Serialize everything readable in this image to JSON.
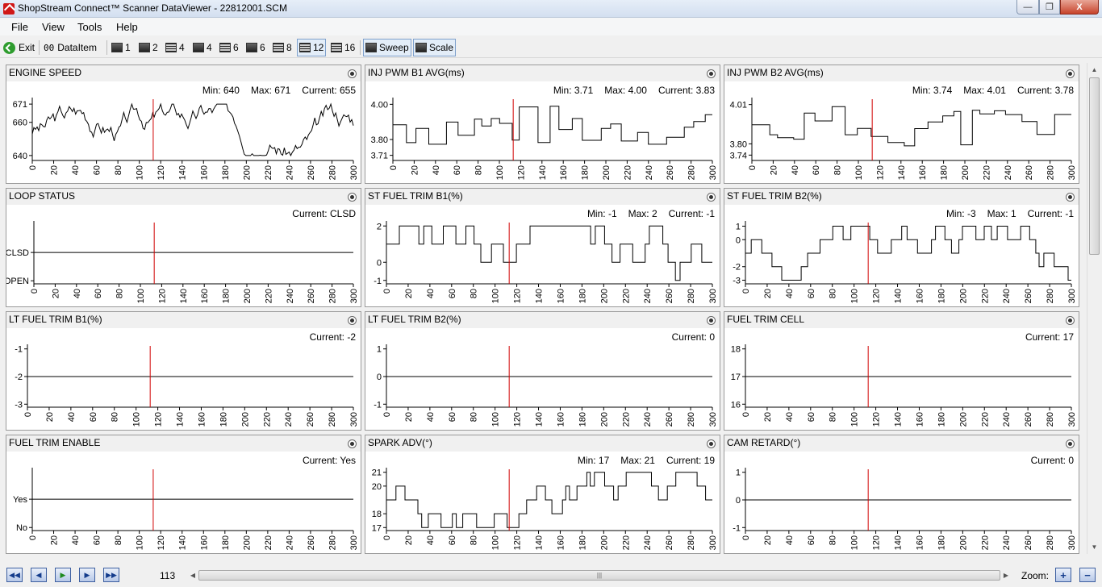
{
  "window": {
    "title": "ShopStream Connect™ Scanner DataViewer - 22812001.SCM",
    "min_glyph": "—",
    "max_glyph": "❐",
    "close_glyph": "X"
  },
  "menu": [
    "File",
    "View",
    "Tools",
    "Help"
  ],
  "toolbar": {
    "exit": "Exit",
    "dataitem": "DataItem",
    "dataitem_icon": "00",
    "layouts": [
      "1",
      "2",
      "4",
      "4",
      "6",
      "6",
      "8",
      "12",
      "16"
    ],
    "active_layout_index": 7,
    "sweep": "Sweep",
    "scale": "Scale"
  },
  "x_ticks": [
    "0",
    "20",
    "40",
    "60",
    "80",
    "100",
    "120",
    "140",
    "160",
    "180",
    "200",
    "220",
    "240",
    "260",
    "280",
    "300"
  ],
  "cursor_position": 113,
  "panels": [
    {
      "title": "ENGINE SPEED",
      "min": "Min: 640",
      "max": "Max: 671",
      "current": "Current: 655",
      "y_ticks": [
        {
          "label": "671",
          "v": 671
        },
        {
          "label": "660",
          "v": 660
        },
        {
          "label": "640",
          "v": 640
        }
      ],
      "y_range": [
        638,
        673
      ],
      "pattern": "noisy",
      "series_range": [
        640,
        671
      ],
      "seed": 3
    },
    {
      "title": "INJ PWM B1 AVG(ms)",
      "min": "Min: 3.71",
      "max": "Max: 4.00",
      "current": "Current: 3.83",
      "y_ticks": [
        {
          "label": "4.00",
          "v": 4.0
        },
        {
          "label": "3.80",
          "v": 3.8
        },
        {
          "label": "3.71",
          "v": 3.71
        }
      ],
      "y_range": [
        3.69,
        4.02
      ],
      "pattern": "step",
      "series_range": [
        3.71,
        4.0
      ],
      "seed": 7
    },
    {
      "title": "INJ PWM B2 AVG(ms)",
      "min": "Min: 3.74",
      "max": "Max: 4.01",
      "current": "Current: 3.78",
      "y_ticks": [
        {
          "label": "4.01",
          "v": 4.01
        },
        {
          "label": "3.80",
          "v": 3.8
        },
        {
          "label": "3.74",
          "v": 3.74
        }
      ],
      "y_range": [
        3.72,
        4.03
      ],
      "pattern": "step",
      "series_range": [
        3.74,
        4.01
      ],
      "seed": 11
    },
    {
      "title": "LOOP STATUS",
      "min": "",
      "max": "",
      "current": "Current: CLSD",
      "y_ticks": [
        {
          "label": "CLSD",
          "v": 1
        },
        {
          "label": "OPEN",
          "v": 0
        }
      ],
      "y_range": [
        -0.05,
        2.0
      ],
      "pattern": "flat",
      "flat_value": 1,
      "seed": 1
    },
    {
      "title": "ST FUEL TRIM B1(%)",
      "min": "Min: -1",
      "max": "Max: 2",
      "current": "Current: -1",
      "y_ticks": [
        {
          "label": "2",
          "v": 2
        },
        {
          "label": "0",
          "v": 0
        },
        {
          "label": "-1",
          "v": -1
        }
      ],
      "y_range": [
        -1.1,
        2.1
      ],
      "pattern": "levels",
      "levels": [
        -1,
        0,
        1,
        2
      ],
      "seed": 5
    },
    {
      "title": "ST FUEL TRIM B2(%)",
      "min": "Min: -3",
      "max": "Max: 1",
      "current": "Current: -1",
      "y_ticks": [
        {
          "label": "1",
          "v": 1
        },
        {
          "label": "0",
          "v": 0
        },
        {
          "label": "-2",
          "v": -2
        },
        {
          "label": "-3",
          "v": -3
        }
      ],
      "y_range": [
        -3.15,
        1.15
      ],
      "pattern": "levels",
      "levels": [
        -3,
        -2,
        -1,
        0,
        1
      ],
      "seed": 9
    },
    {
      "title": "LT FUEL TRIM B1(%)",
      "min": "",
      "max": "",
      "current": "Current: -2",
      "y_ticks": [
        {
          "label": "-1",
          "v": -1
        },
        {
          "label": "-2",
          "v": -2
        },
        {
          "label": "-3",
          "v": -3
        }
      ],
      "y_range": [
        -3.05,
        -0.95
      ],
      "pattern": "flat",
      "flat_value": -2,
      "seed": 1
    },
    {
      "title": "LT FUEL TRIM B2(%)",
      "min": "",
      "max": "",
      "current": "Current: 0",
      "y_ticks": [
        {
          "label": "1",
          "v": 1
        },
        {
          "label": "0",
          "v": 0
        },
        {
          "label": "-1",
          "v": -1
        }
      ],
      "y_range": [
        -1.05,
        1.05
      ],
      "pattern": "flat",
      "flat_value": 0,
      "seed": 1
    },
    {
      "title": "FUEL TRIM CELL",
      "min": "",
      "max": "",
      "current": "Current: 17",
      "y_ticks": [
        {
          "label": "18",
          "v": 18
        },
        {
          "label": "17",
          "v": 17
        },
        {
          "label": "16",
          "v": 16
        }
      ],
      "y_range": [
        15.95,
        18.05
      ],
      "pattern": "flat",
      "flat_value": 17,
      "seed": 1
    },
    {
      "title": "FUEL TRIM ENABLE",
      "min": "",
      "max": "",
      "current": "Current: Yes",
      "y_ticks": [
        {
          "label": "Yes",
          "v": 1
        },
        {
          "label": "No",
          "v": 0
        }
      ],
      "y_range": [
        -0.05,
        2.0
      ],
      "pattern": "flat",
      "flat_value": 1,
      "seed": 1
    },
    {
      "title": "SPARK ADV(°)",
      "min": "Min: 17",
      "max": "Max: 21",
      "current": "Current: 19",
      "y_ticks": [
        {
          "label": "21",
          "v": 21
        },
        {
          "label": "20",
          "v": 20
        },
        {
          "label": "18",
          "v": 18
        },
        {
          "label": "17",
          "v": 17
        }
      ],
      "y_range": [
        16.9,
        21.1
      ],
      "pattern": "levels",
      "levels": [
        17,
        18,
        19,
        20,
        21
      ],
      "seed": 13
    },
    {
      "title": "CAM RETARD(°)",
      "min": "",
      "max": "",
      "current": "Current: 0",
      "y_ticks": [
        {
          "label": "1",
          "v": 1
        },
        {
          "label": "0",
          "v": 0
        },
        {
          "label": "-1",
          "v": -1
        }
      ],
      "y_range": [
        -1.05,
        1.05
      ],
      "pattern": "flat",
      "flat_value": 0,
      "seed": 1
    }
  ],
  "bottom": {
    "frame": "113",
    "zoom_label": "Zoom:",
    "grip": "|||"
  }
}
